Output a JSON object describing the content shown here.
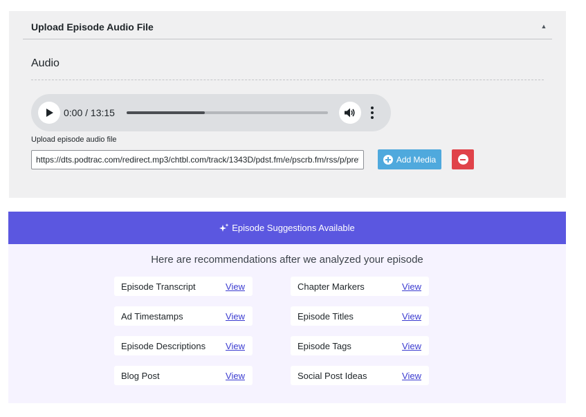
{
  "upload_panel": {
    "title": "Upload Episode Audio File",
    "section_label": "Audio",
    "player": {
      "time": "0:00 / 13:15",
      "progress_fraction": 0.39
    },
    "field_label": "Upload episode audio file",
    "audio_url": "https://dts.podtrac.com/redirect.mp3/chtbl.com/track/1343D/pdst.fm/e/pscrb.fm/rss/p/prefix.podtrac.com",
    "add_media_label": "Add Media"
  },
  "suggestions": {
    "banner_label": "Episode Suggestions Available",
    "intro": "Here are recommendations after we analyzed your episode",
    "link_label": "View",
    "items": [
      {
        "name": "Episode Transcript"
      },
      {
        "name": "Chapter Markers"
      },
      {
        "name": "Ad Timestamps"
      },
      {
        "name": "Episode Titles"
      },
      {
        "name": "Episode Descriptions"
      },
      {
        "name": "Episode Tags"
      },
      {
        "name": "Blog Post"
      },
      {
        "name": "Social Post Ideas"
      }
    ]
  },
  "colors": {
    "banner": "#5b57e0",
    "add_media": "#4fa9dd",
    "remove": "#e0434a",
    "link": "#3a3ad0"
  }
}
